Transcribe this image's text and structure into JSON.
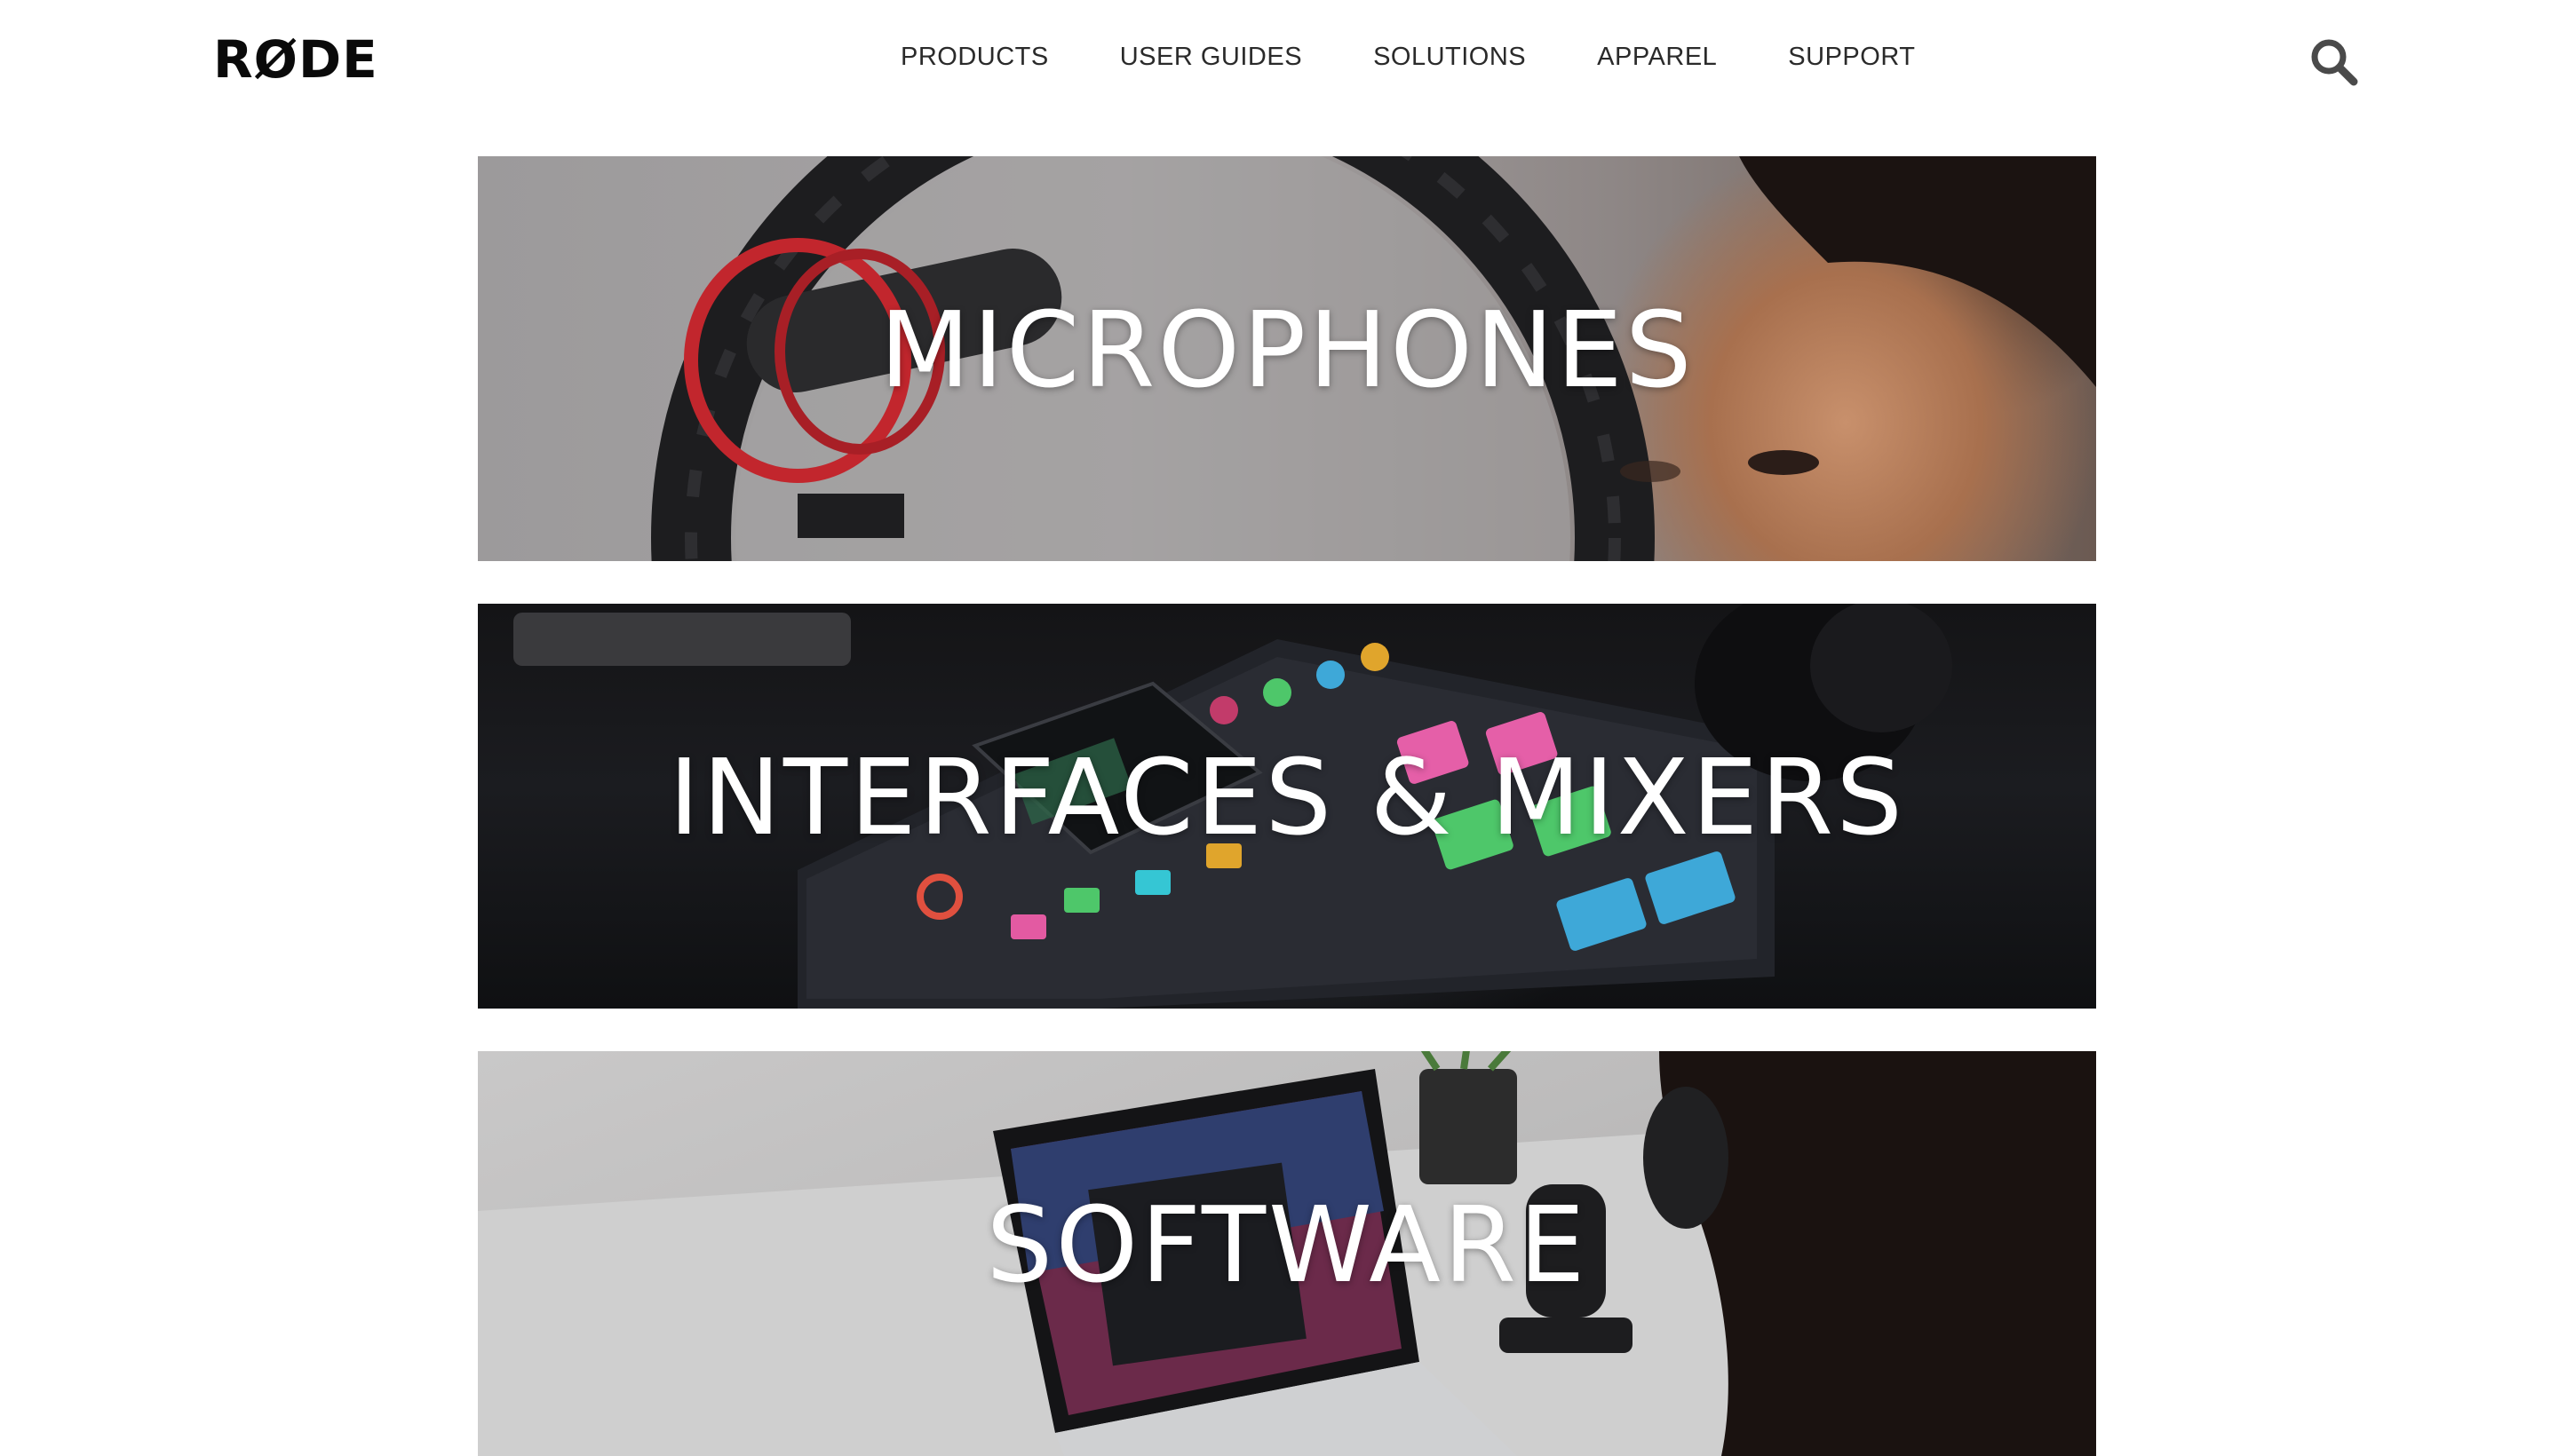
{
  "header": {
    "logo_text": "RØDE",
    "nav": [
      {
        "label": "PRODUCTS"
      },
      {
        "label": "USER GUIDES"
      },
      {
        "label": "SOLUTIONS"
      },
      {
        "label": "APPAREL"
      },
      {
        "label": "SUPPORT"
      }
    ],
    "search_icon": "search-icon"
  },
  "categories": [
    {
      "label": "MICROPHONES"
    },
    {
      "label": "INTERFACES & MIXERS"
    },
    {
      "label": "SOFTWARE"
    }
  ],
  "colors": {
    "text_dark": "#2a2a2a",
    "logo": "#0a0a0a",
    "tile_text": "#ffffff"
  }
}
